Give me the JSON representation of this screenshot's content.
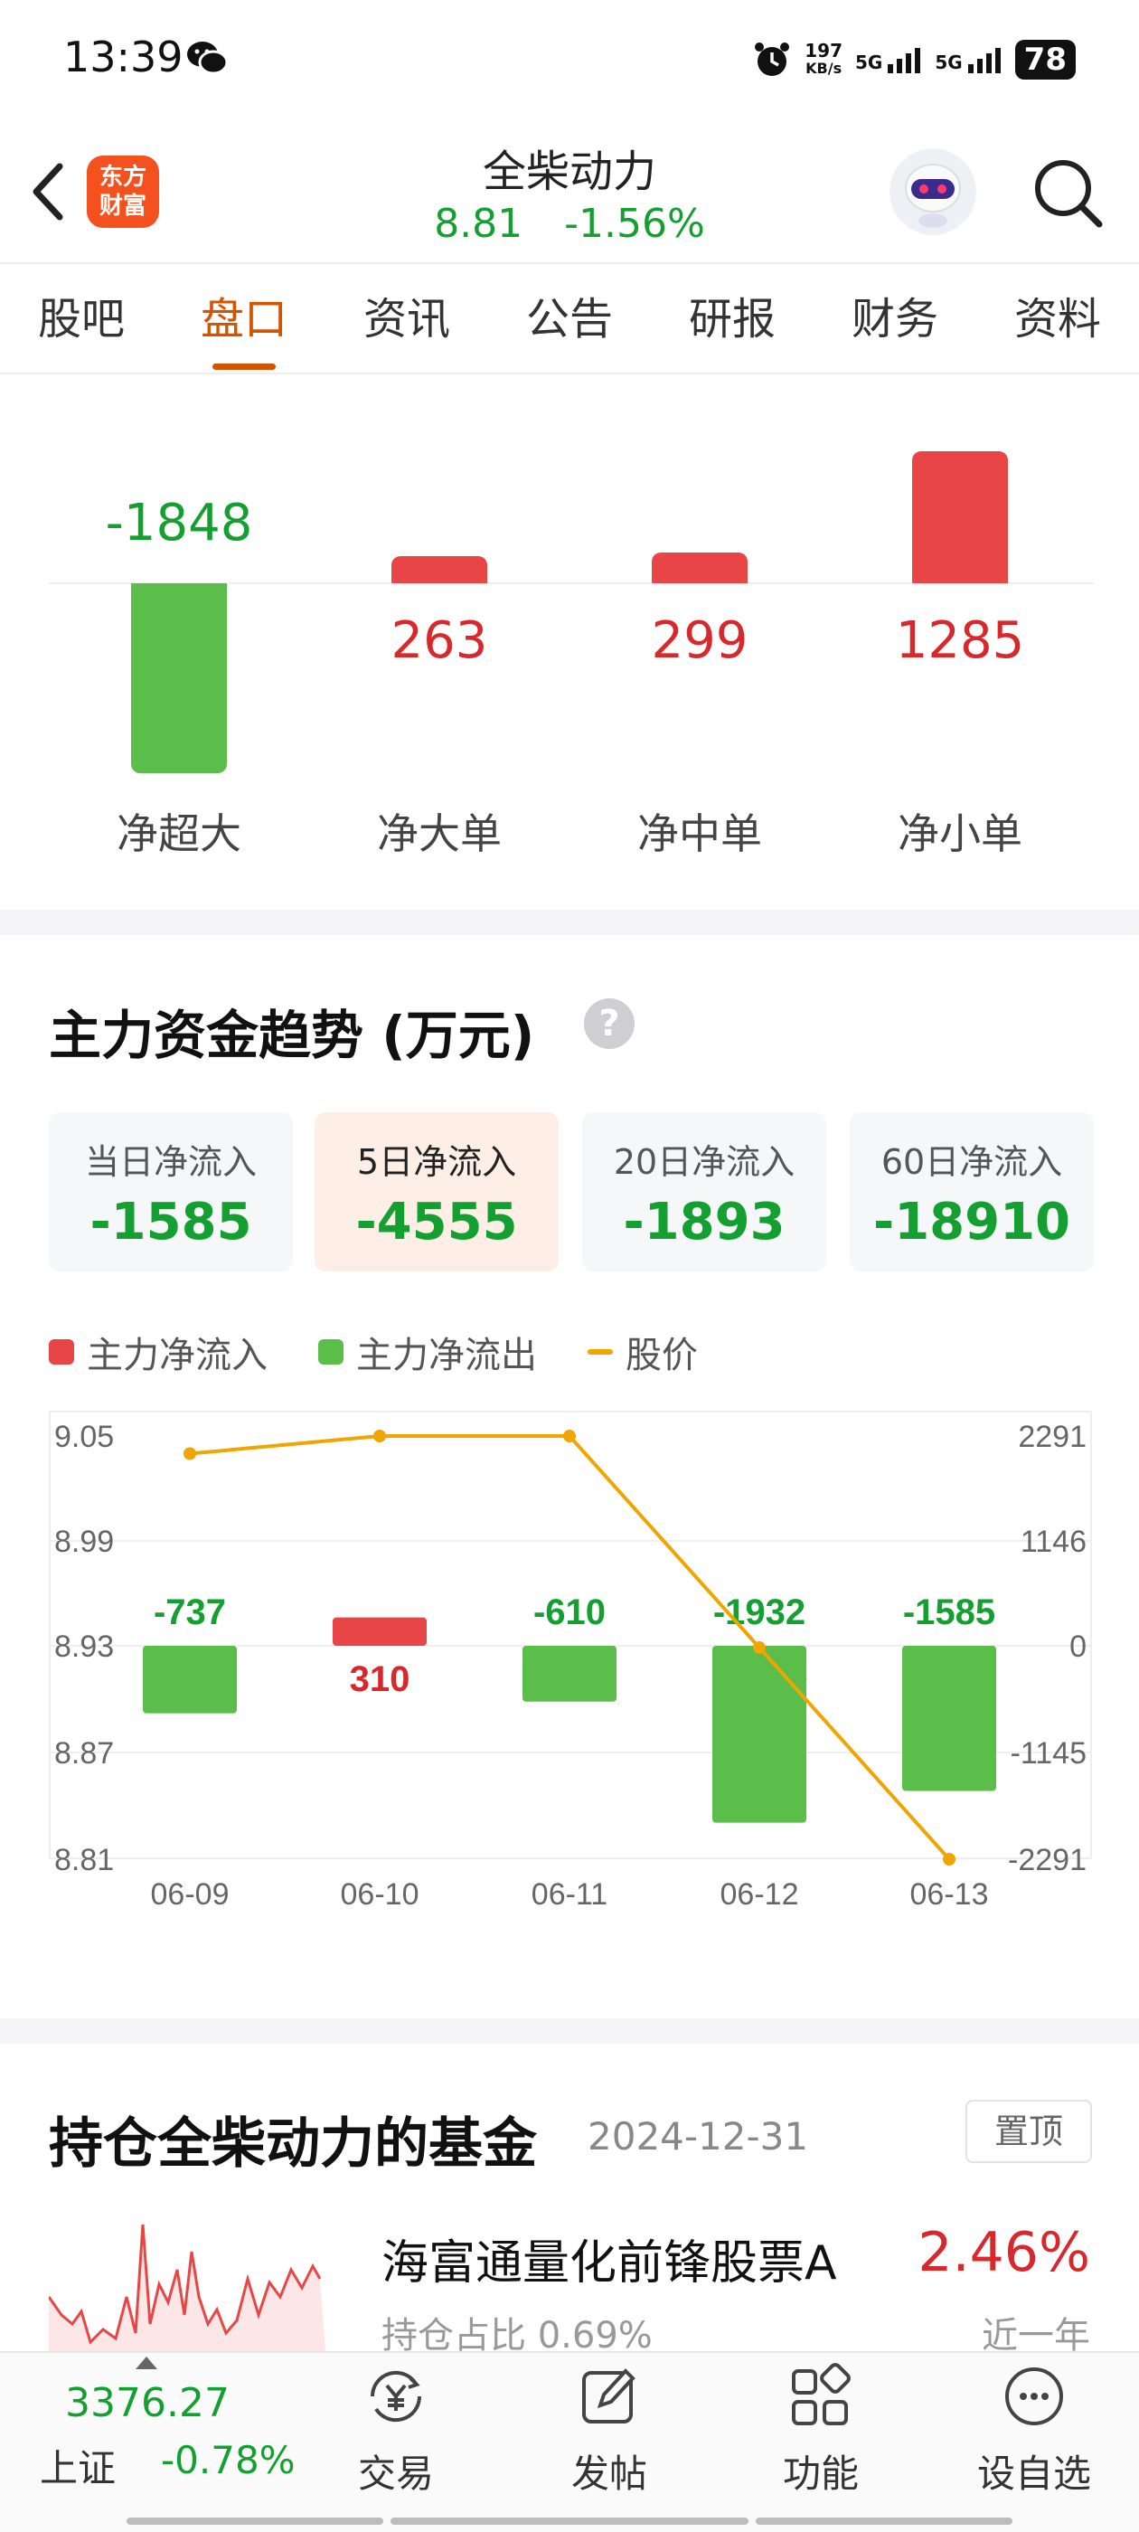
{
  "status_bar": {
    "time": "13:39",
    "net_speed_value": "197",
    "net_speed_unit": "KB/s",
    "sim1": "5G",
    "sim2": "5G",
    "battery": "78"
  },
  "header": {
    "logo_line1": "东方",
    "logo_line2": "财富",
    "stock_name": "全柴动力",
    "price": "8.81",
    "change_pct": "-1.56%"
  },
  "tabs": [
    "股吧",
    "盘口",
    "资讯",
    "公告",
    "研报",
    "财务",
    "资料"
  ],
  "active_tab": "盘口",
  "order_flow": {
    "items": [
      {
        "label": "净超大",
        "value": "-1848"
      },
      {
        "label": "净大单",
        "value": "263"
      },
      {
        "label": "净中单",
        "value": "299"
      },
      {
        "label": "净小单",
        "value": "1285"
      }
    ]
  },
  "trend": {
    "title": "主力资金趋势 (万元)",
    "help_icon": "?",
    "cards": [
      {
        "label": "当日净流入",
        "value": "-1585"
      },
      {
        "label": "5日净流入",
        "value": "-4555"
      },
      {
        "label": "20日净流入",
        "value": "-1893"
      },
      {
        "label": "60日净流入",
        "value": "-18910"
      }
    ],
    "active_card": "5日净流入",
    "legend": {
      "inflow": "主力净流入",
      "outflow": "主力净流出",
      "price": "股价"
    }
  },
  "chart_data": {
    "type": "bar",
    "categories": [
      "06-09",
      "06-10",
      "06-11",
      "06-12",
      "06-13"
    ],
    "series": [
      {
        "name": "主力净流入/主力净流出",
        "values": [
          -737,
          310,
          -610,
          -1932,
          -1585
        ],
        "labels": [
          "-737",
          "310",
          "-610",
          "-1932",
          "-1585"
        ]
      },
      {
        "name": "股价",
        "type": "line",
        "values": [
          9.04,
          9.05,
          9.05,
          8.93,
          8.81
        ]
      }
    ],
    "y_left_ticks": [
      "9.05",
      "8.99",
      "8.93",
      "8.87",
      "8.81"
    ],
    "y_left_range": [
      8.81,
      9.05
    ],
    "y_right_ticks": [
      "2291",
      "1146",
      "0",
      "-1145",
      "-2291"
    ],
    "y_right_range": [
      -2291,
      2291
    ],
    "colors": {
      "inflow": "#e84646",
      "outflow": "#5bbd4a",
      "price": "#f0a500",
      "down_text": "#13a031",
      "up_text": "#d8282b"
    }
  },
  "fund": {
    "title": "持仓全柴动力的基金",
    "date": "2024-12-31",
    "pin_label": "置顶",
    "name": "海富通量化前锋股票A",
    "return": "2.46%",
    "holding": "持仓占比  0.69%",
    "period": "近一年"
  },
  "bottom_bar": {
    "index_value": "3376.27",
    "index_name": "上证",
    "index_change": "-0.78%",
    "nav": [
      {
        "label": "交易",
        "icon": "yuan-refresh-icon"
      },
      {
        "label": "发帖",
        "icon": "edit-icon"
      },
      {
        "label": "功能",
        "icon": "grid-icon"
      },
      {
        "label": "设自选",
        "icon": "more-icon"
      }
    ]
  }
}
